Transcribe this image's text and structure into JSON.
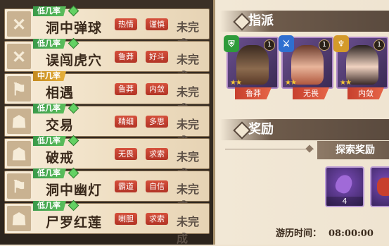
{
  "events": [
    {
      "tier": "低几率",
      "name": "洞中弹球",
      "tags": [
        "热情",
        "谨慎"
      ],
      "status": "未完成",
      "icon": "crossed-swords",
      "tier_level": "low"
    },
    {
      "tier": "低几率",
      "name": "误闯虎穴",
      "tags": [
        "鲁莽",
        "好斗"
      ],
      "status": "未完成",
      "icon": "crossed-swords",
      "tier_level": "low"
    },
    {
      "tier": "中几率",
      "name": "相遇",
      "tags": [
        "鲁莽",
        "内敛"
      ],
      "status": "未完成",
      "icon": "flag",
      "tier_level": "mid"
    },
    {
      "tier": "低几率",
      "name": "交易",
      "tags": [
        "精细",
        "多思"
      ],
      "status": "未完成",
      "icon": "person",
      "tier_level": "low"
    },
    {
      "tier": "低几率",
      "name": "破戒",
      "tags": [
        "无畏",
        "求索"
      ],
      "status": "未完成",
      "icon": "person",
      "tier_level": "low"
    },
    {
      "tier": "低几率",
      "name": "洞中幽灯",
      "tags": [
        "霸道",
        "自信"
      ],
      "status": "未完成",
      "icon": "flag",
      "tier_level": "low"
    },
    {
      "tier": "低几率",
      "name": "尸罗红莲",
      "tags": [
        "喇胆",
        "求索"
      ],
      "status": "未完成",
      "icon": "person",
      "tier_level": "low"
    }
  ],
  "dispatch": {
    "title": "指派",
    "heroes": [
      {
        "trait": "鲁莽",
        "level": "1",
        "stars": "★★",
        "badge_color": "#2e9b3a"
      },
      {
        "trait": "无畏",
        "level": "1",
        "stars": "★★",
        "badge_color": "#2f6fd0"
      },
      {
        "trait": "内敛",
        "level": "1",
        "stars": "★★",
        "badge_color": "#d39a2a"
      }
    ]
  },
  "rewards": {
    "title": "奖励",
    "subtitle": "探索奖励",
    "items": [
      {
        "count": "4"
      },
      {
        "count": ""
      }
    ]
  },
  "timer": {
    "label": "游历时间：",
    "value": "08:00:00"
  }
}
